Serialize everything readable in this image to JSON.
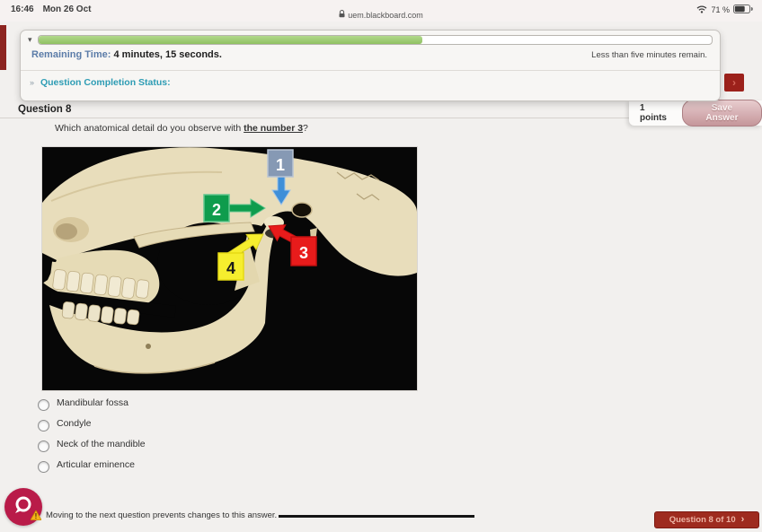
{
  "status_bar": {
    "time": "16:46",
    "date": "Mon 26 Oct",
    "url": "uem.blackboard.com",
    "battery_percent": "71 %"
  },
  "timer_panel": {
    "collapse_icon": "▾",
    "progress_percent": 57,
    "remaining_label": "Remaining Time:",
    "remaining_value": "4 minutes, 15 seconds.",
    "time_warning": "Less than five minutes remain.",
    "completion_marker": "»",
    "completion_label": "Question Completion Status:"
  },
  "question": {
    "header": "Question 8",
    "points_label": "1 points",
    "save_button_label": "Save Answer",
    "text_before": "Which anatomical detail do you observe with ",
    "text_emphasis": "the number 3",
    "text_after": "?"
  },
  "skull_figure": {
    "description": "Lateral photograph of a human skull on black background with four numbered arrows pointing at the temporomandibular joint region",
    "labels": [
      {
        "number": "1",
        "color": "#8699b4"
      },
      {
        "number": "2",
        "color": "#0f9c4d"
      },
      {
        "number": "3",
        "color": "#e81b1b"
      },
      {
        "number": "4",
        "color": "#f6ee2e"
      }
    ]
  },
  "options": [
    {
      "label": "Mandibular fossa"
    },
    {
      "label": "Condyle"
    },
    {
      "label": "Neck of the mandible"
    },
    {
      "label": "Articular eminence"
    }
  ],
  "footer": {
    "warning_text": "Moving to the next question prevents changes to this answer.",
    "nav_label": "Question 8 of 10",
    "nav_chevron": "›"
  },
  "colors": {
    "brand_maroon": "#9c211b",
    "chat_pink": "#b91b49",
    "progress_green": "#8fc162",
    "link_teal": "#2d9cb4",
    "timer_blue": "#5b7ca8"
  }
}
